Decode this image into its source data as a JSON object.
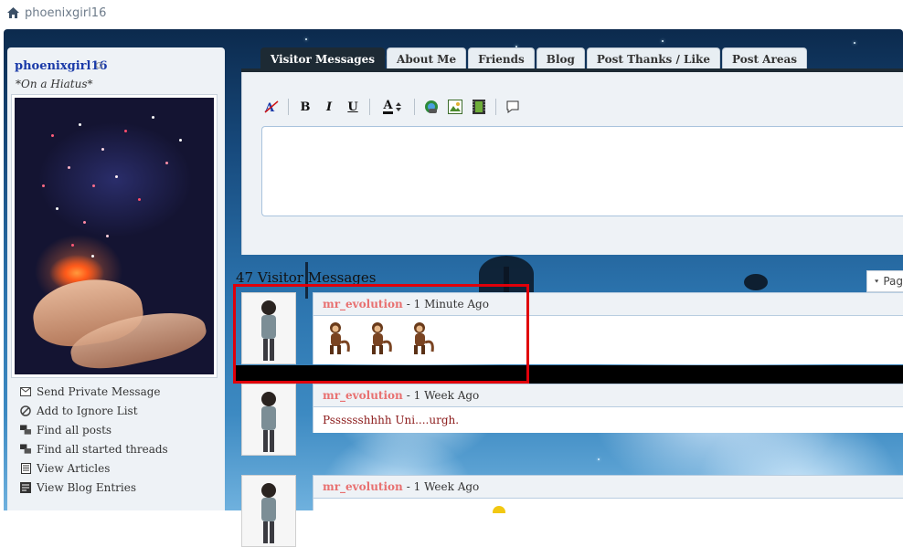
{
  "breadcrumb": {
    "home_icon": "home-icon",
    "label": "phoenixgirl16"
  },
  "profile": {
    "username": "phoenixgirl16",
    "user_title": "*On a Hiatus*",
    "links": [
      {
        "icon": "envelope-icon",
        "label": "Send Private Message"
      },
      {
        "icon": "block-icon",
        "label": "Add to Ignore List"
      },
      {
        "icon": "posts-icon",
        "label": "Find all posts"
      },
      {
        "icon": "threads-icon",
        "label": "Find all started threads"
      },
      {
        "icon": "article-icon",
        "label": "View Articles"
      },
      {
        "icon": "blog-icon",
        "label": "View Blog Entries"
      }
    ]
  },
  "tabs": [
    {
      "label": "Visitor Messages",
      "active": true
    },
    {
      "label": "About Me",
      "active": false
    },
    {
      "label": "Friends",
      "active": false
    },
    {
      "label": "Blog",
      "active": false
    },
    {
      "label": "Post Thanks / Like",
      "active": false
    },
    {
      "label": "Post Areas",
      "active": false
    }
  ],
  "editor": {
    "toolbar": [
      "remove-format-icon",
      "bold-icon",
      "italic-icon",
      "underline-icon",
      "font-color-icon",
      "link-icon",
      "image-icon",
      "video-icon",
      "quote-icon"
    ],
    "bold": "B",
    "italic": "I",
    "underline": "U",
    "font_color": "A"
  },
  "messages_header": {
    "count_text": "47 Visitor Messages",
    "pagination_label": "Pag"
  },
  "messages": [
    {
      "author": "mr_evolution",
      "time": "- 1 Minute Ago",
      "body": ""
    },
    {
      "author": "mr_evolution",
      "time": "- 1 Week Ago",
      "body": "Psssssshhhh Uni....urgh."
    },
    {
      "author": "mr_evolution",
      "time": "- 1 Week Ago",
      "body": ""
    }
  ],
  "colors": {
    "accent": "#1a3aa8",
    "author": "#e87070",
    "highlight": "#e0000a",
    "tab_active": "#1d2a34"
  }
}
